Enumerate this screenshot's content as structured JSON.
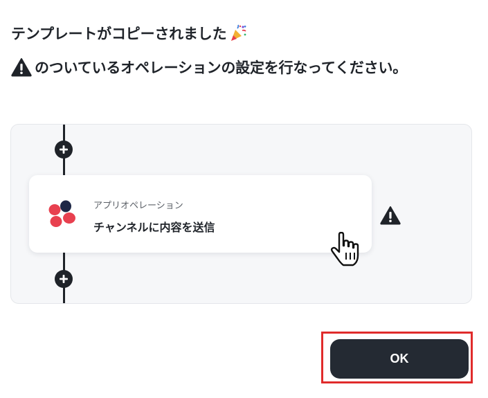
{
  "dialog": {
    "message_line1": "テンプレートがコピーされました",
    "message_line1_icon": "party-popper-icon",
    "message_line2": "のついているオペレーションの設定を行なってください。",
    "message_line2_icon": "warning-icon"
  },
  "flow": {
    "operation": {
      "app_icon": "app-logo-icon",
      "subtitle": "アプリオペレーション",
      "title": "チャンネルに内容を送信",
      "status_icon": "warning-icon"
    },
    "add_step_icon": "plus-icon"
  },
  "footer": {
    "ok_label": "OK"
  },
  "colors": {
    "text": "#1f2329",
    "button_bg": "#242a33",
    "highlight": "#e02b2b",
    "canvas_bg": "#f6f7f9",
    "logo_red": "#e8404f",
    "logo_navy": "#1e2746"
  }
}
